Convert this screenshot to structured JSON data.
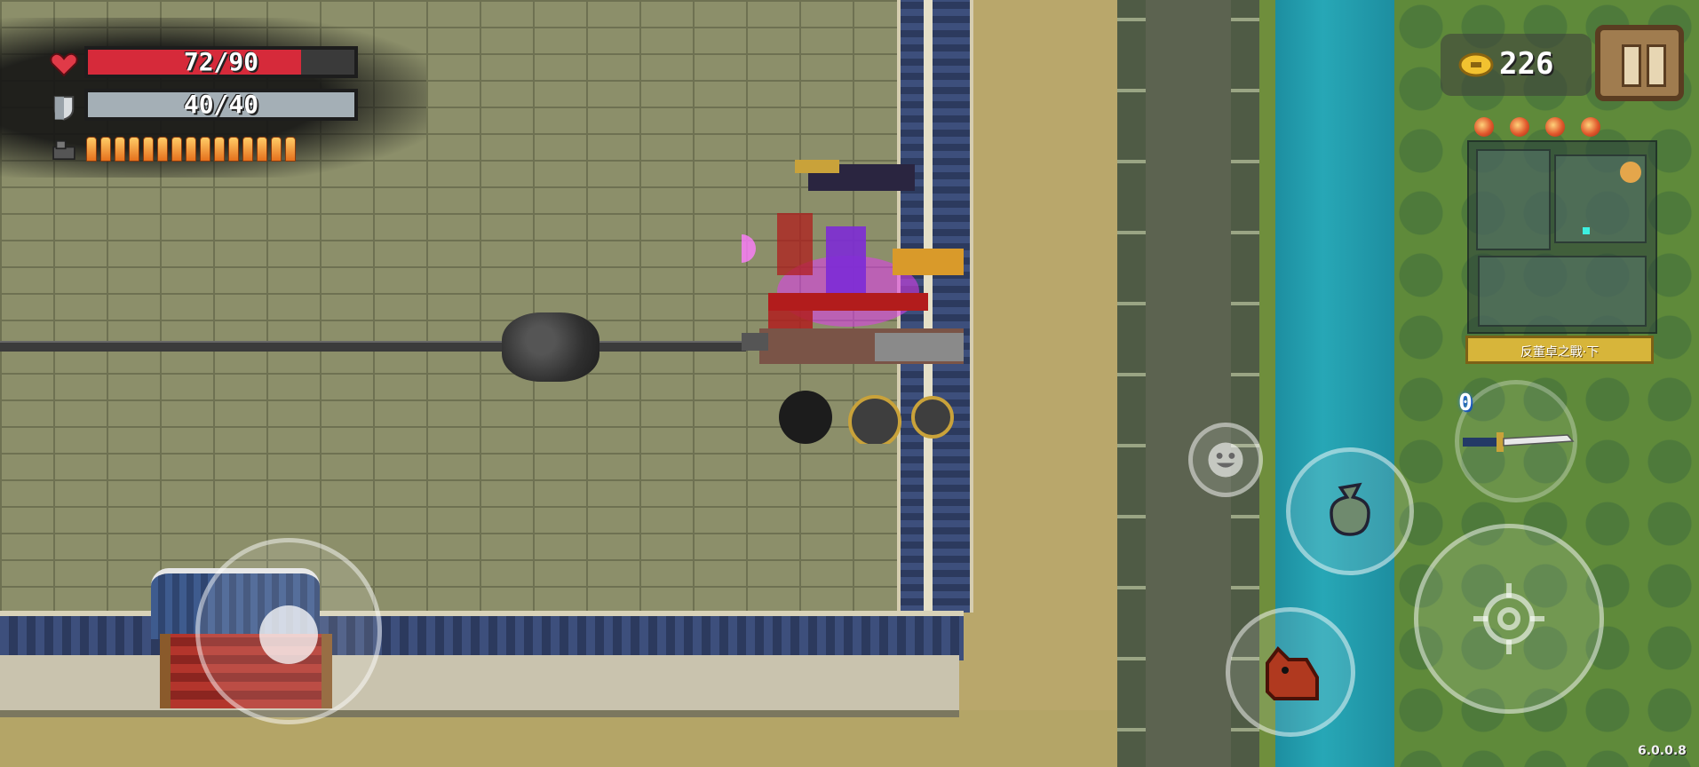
{
  "hud": {
    "health": {
      "current": 72,
      "max": 90,
      "text": "72/90",
      "color": "#d62a3a",
      "icon": "heart-icon"
    },
    "armor": {
      "current": 40,
      "max": 40,
      "text": "40/40",
      "color": "#a4afb6",
      "icon": "shield-icon"
    },
    "energy": {
      "bullet_count": 15,
      "icon": "energy-icon"
    }
  },
  "currency": {
    "coins": "226",
    "icon": "coin-icon"
  },
  "pause": {
    "icon": "pause-icon"
  },
  "buffs": {
    "count": 4,
    "icon": "buff-orb-icon"
  },
  "minimap": {
    "level_name": "反董卓之戰·下"
  },
  "controls": {
    "weapon_energy_cost": "0",
    "weapon_icon": "katana-icon",
    "skill_icon": "pouch-icon",
    "pet_icon": "boar-icon",
    "fire_icon": "crosshair-icon",
    "emote_icon": "smiley-icon"
  },
  "version": "6.0.0.8",
  "colors": {
    "health_fill": "#d62a3a",
    "armor_fill": "#a4afb6",
    "river": "#27a7b6",
    "floor": "#8c8f6a",
    "level_label_bg": "#d7b53a"
  }
}
